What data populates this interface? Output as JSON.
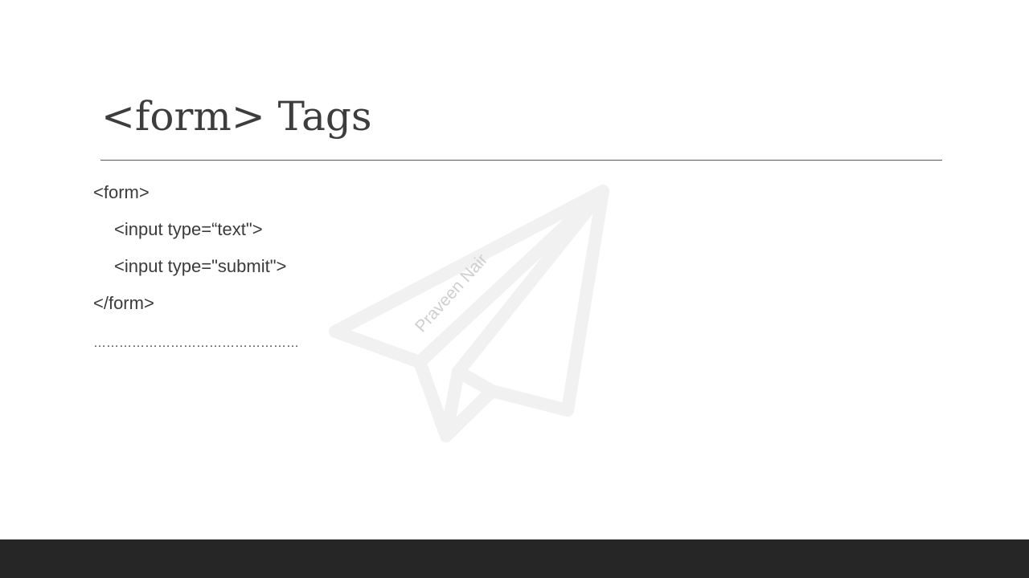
{
  "slide": {
    "title": "<form> Tags",
    "lines": [
      "<form>",
      "<input type=“text\">",
      "<input type=\"submit\">",
      "</form>"
    ],
    "dotted_line": "…………………………………………",
    "watermark_text": "Praveen Nair"
  },
  "colors": {
    "text": "#3a3a3a",
    "rule": "#595959",
    "watermark": "#f1f1f1",
    "footer": "#262626"
  },
  "icons": {
    "watermark": "paper-plane-icon"
  }
}
